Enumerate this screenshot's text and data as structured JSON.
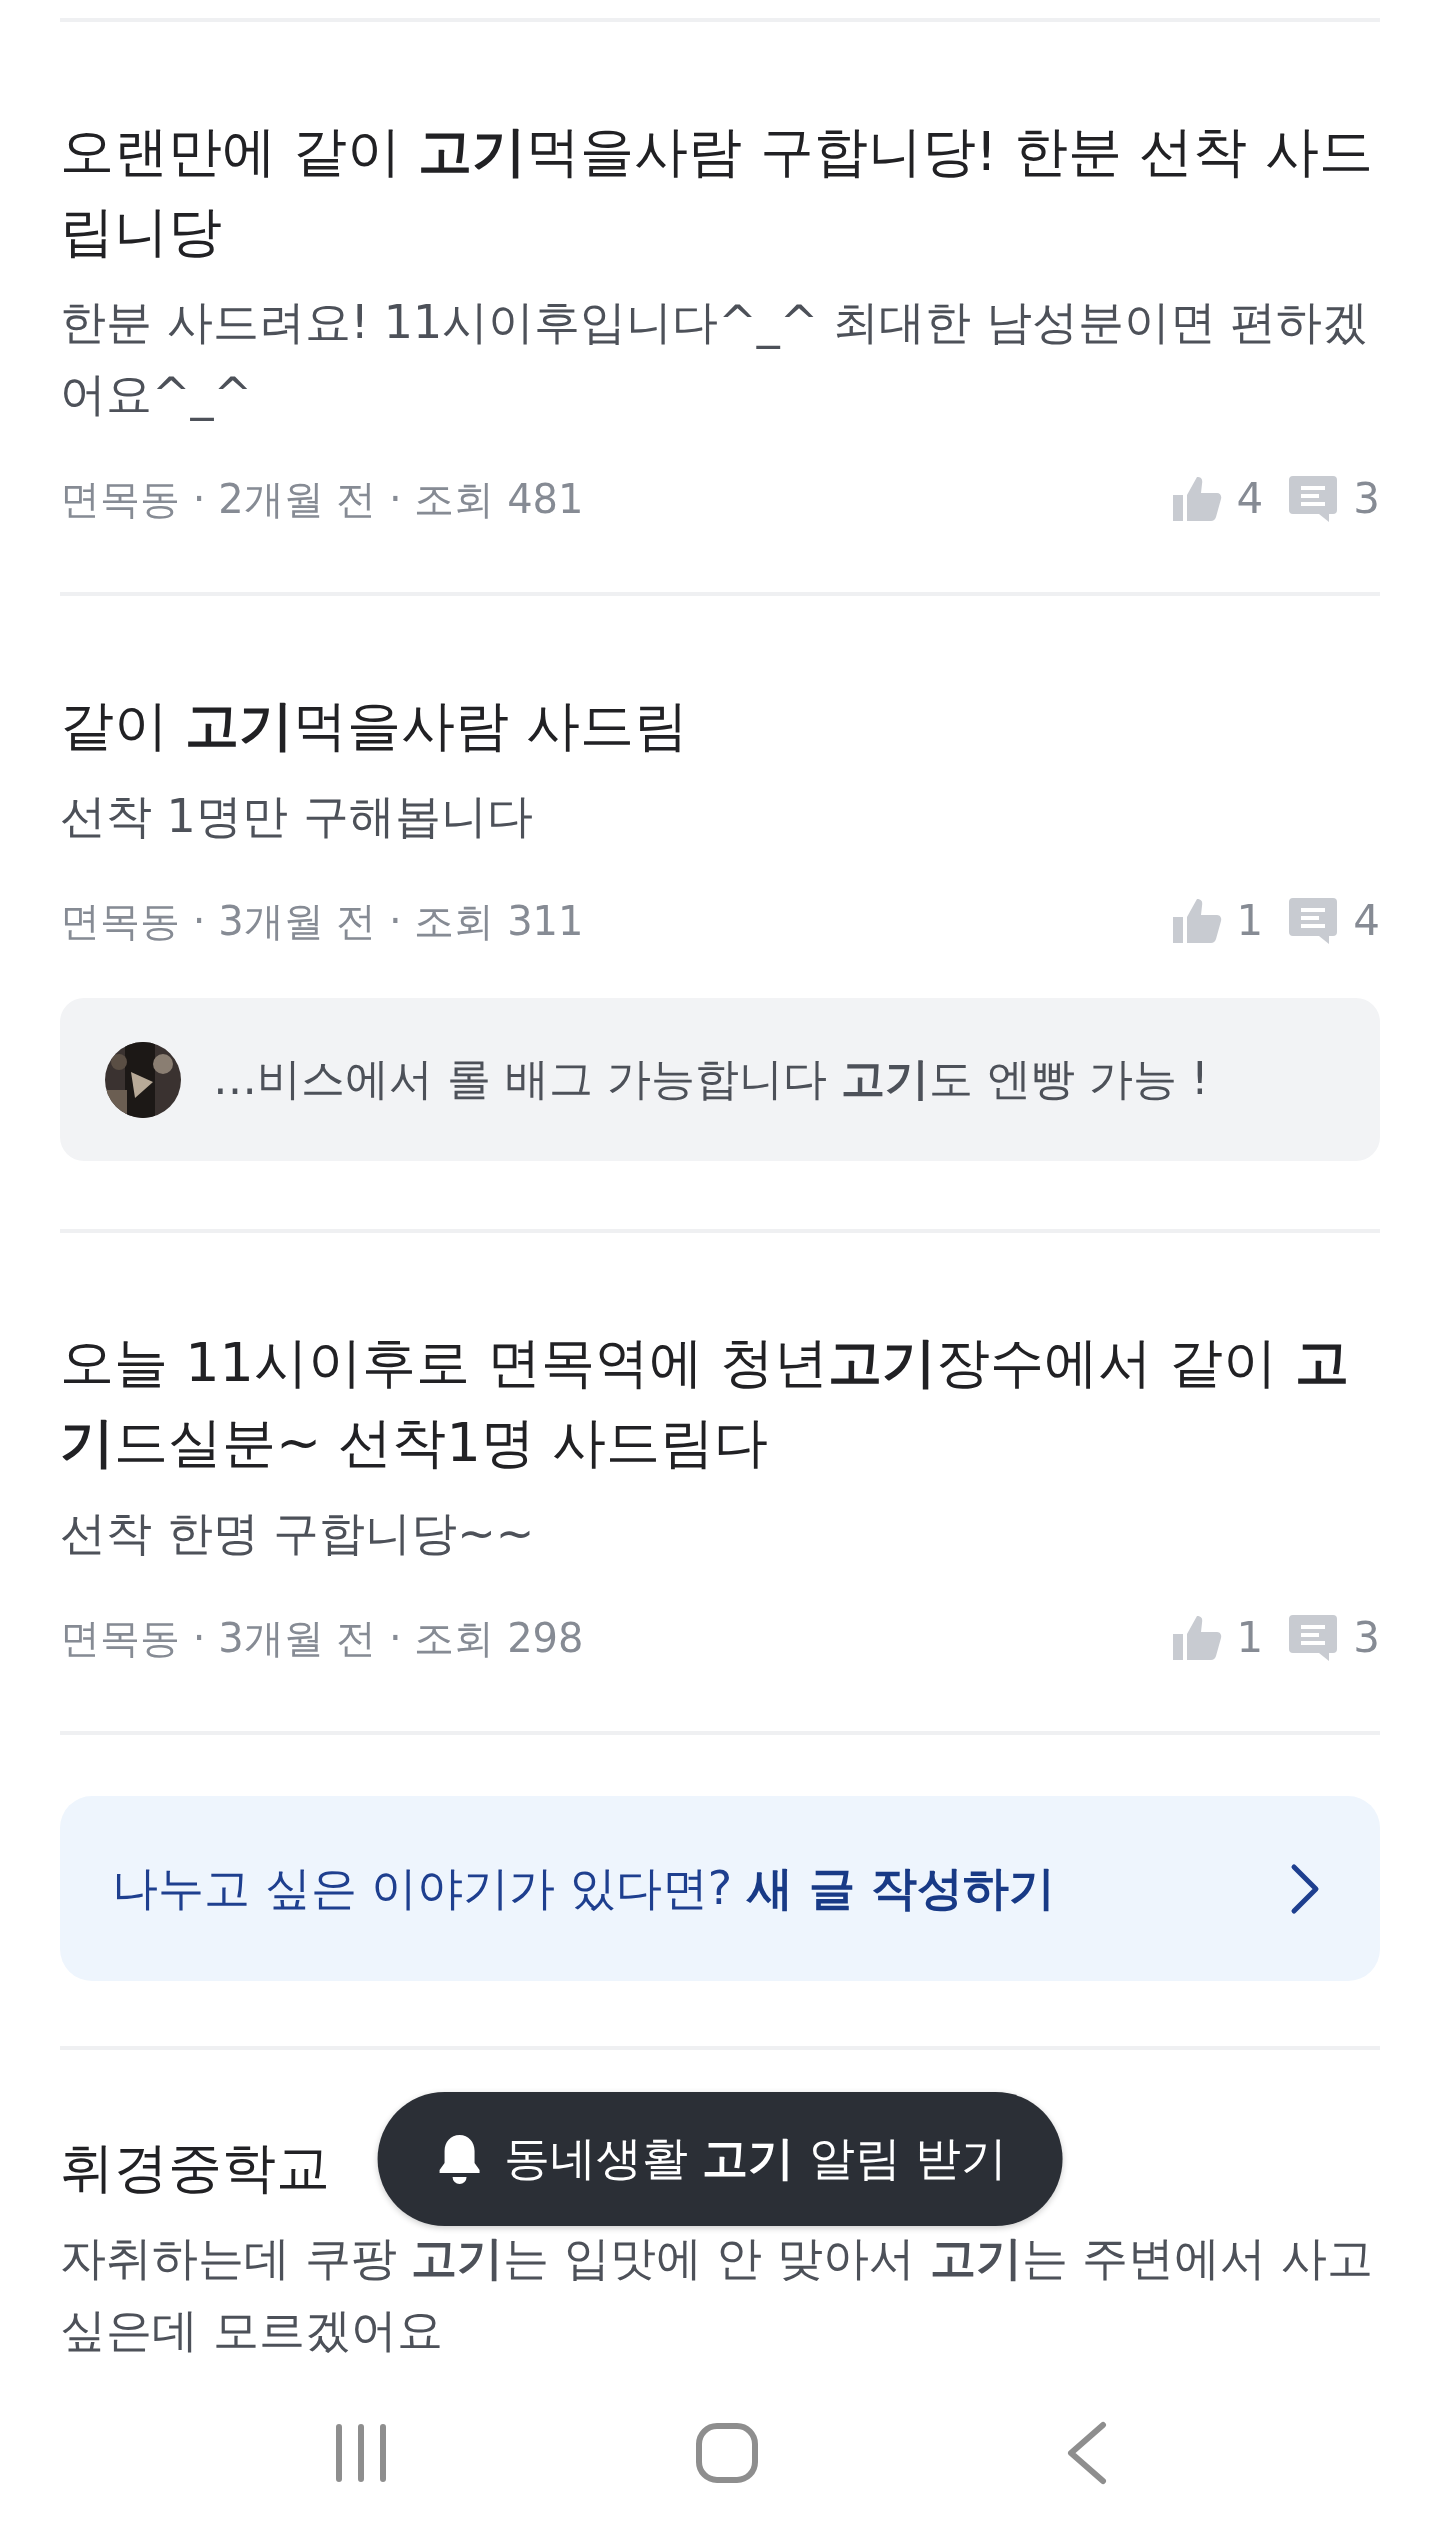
{
  "posts": [
    {
      "title": "오랜만에 같이 **고기**먹을사람 구합니당! 한분 선착 사드립니당",
      "body": "한분 사드려요! 11시이후입니다^_^ 최대한 남성분이면 편하겠어요^_^",
      "meta": "면목동 · 2개월 전 · 조회 481",
      "likes": "4",
      "comments": "3"
    },
    {
      "title": "같이 **고기**먹을사람 사드림",
      "body": "선착 1명만 구해봅니다",
      "meta": "면목동 · 3개월 전 · 조회 311",
      "likes": "1",
      "comments": "4",
      "comment_preview": {
        "text": "…비스에서 롤 배그 가능합니다 **고기**도 엔빵 가능 !"
      }
    },
    {
      "title": "오늘 11시이후로 면목역에 청년**고기**장수에서 같이 **고기**드실분~ 선착1명 사드림다",
      "body": "선착 한명 구합니당~~",
      "meta": "면목동 · 3개월 전 · 조회 298",
      "likes": "1",
      "comments": "3"
    }
  ],
  "write_banner": {
    "text": "나누고 싶은 이야기가 있다면? **새 글 작성하기**"
  },
  "partial_post": {
    "title": "휘경중학교",
    "body": "자취하는데 쿠팡 **고기**는 입맛에 안 맞아서 **고기**는 주변에서 사고 싶은데 모르겠어요"
  },
  "toast": {
    "text": "동네생활 **고기** 알림 받기"
  }
}
